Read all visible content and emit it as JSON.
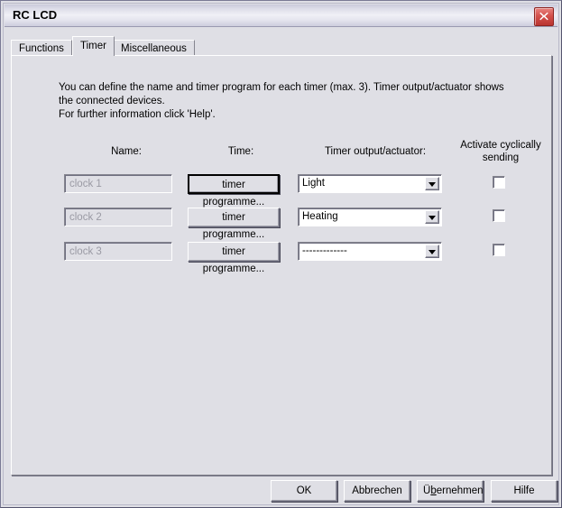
{
  "window": {
    "title": "RC LCD",
    "close_icon": "close-x-icon"
  },
  "tabs": [
    {
      "label": "Functions",
      "selected": false
    },
    {
      "label": "Timer",
      "selected": true
    },
    {
      "label": "Miscellaneous",
      "selected": false
    }
  ],
  "panel": {
    "info_line1": "You can define the name and timer program for each timer (max. 3). Timer output/actuator shows",
    "info_line2": "the connected devices.",
    "info_line3": "For further information click 'Help'.",
    "headers": {
      "name": "Name:",
      "time": "Time:",
      "output": "Timer output/actuator:",
      "cyclic_line1": "Activate cyclically",
      "cyclic_line2": "sending"
    },
    "rows": [
      {
        "name_value": "clock 1",
        "name_disabled": true,
        "time_button": "timer programme...",
        "actuator": "Light",
        "cyclic_checked": false
      },
      {
        "name_value": "clock 2",
        "name_disabled": true,
        "time_button": "timer programme...",
        "actuator": "Heating",
        "cyclic_checked": false
      },
      {
        "name_value": "clock 3",
        "name_disabled": true,
        "time_button": "timer programme...",
        "actuator": "-------------",
        "cyclic_checked": false
      }
    ]
  },
  "buttons": {
    "ok": "OK",
    "cancel": "Abbrechen",
    "apply_prefix": "Ü",
    "apply_mnemonic": "b",
    "apply_suffix": "ernehmen",
    "help": "Hilfe"
  },
  "colors": {
    "face": "#dfdfe5",
    "close_red": "#d4514c",
    "disabled_text": "#9a9aa4",
    "shadow": "#85858f"
  }
}
